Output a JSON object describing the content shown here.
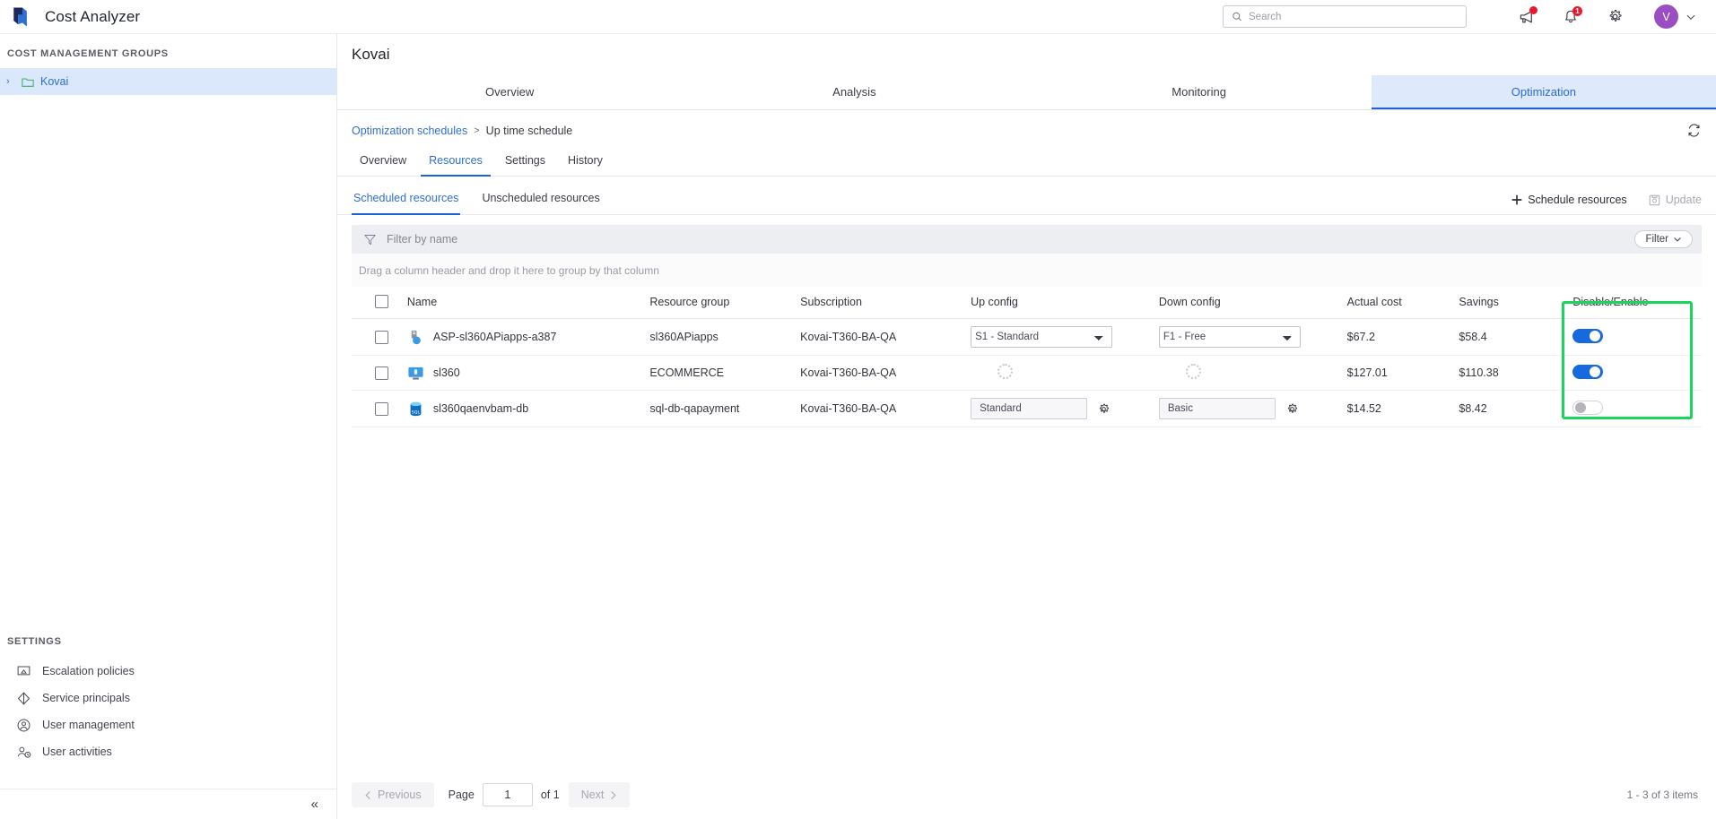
{
  "app": {
    "title": "Cost Analyzer",
    "logo_icon": "azure-cost-logo-icon"
  },
  "topbar": {
    "search_placeholder": "Search",
    "search_value": "",
    "search_icon": "search-icon",
    "announcement_icon": "megaphone-icon",
    "announcement_badge": "",
    "notifications_icon": "bell-icon",
    "notifications_badge": "1",
    "settings_icon": "gear-icon",
    "avatar_initial": "V",
    "avatar_chevron_icon": "chevron-down-icon"
  },
  "sidebar": {
    "groups_title": "COST MANAGEMENT GROUPS",
    "tree": [
      {
        "label": "Kovai",
        "expand_icon": "chevron-right-icon",
        "folder_icon": "folder-icon",
        "selected": true
      }
    ],
    "settings_title": "SETTINGS",
    "settings_items": [
      {
        "label": "Escalation policies",
        "icon": "escalation-policy-icon"
      },
      {
        "label": "Service principals",
        "icon": "service-principal-icon"
      },
      {
        "label": "User management",
        "icon": "user-circle-icon"
      },
      {
        "label": "User activities",
        "icon": "user-activity-icon"
      }
    ],
    "collapse_icon": "collapse-double-chevron-left-icon"
  },
  "main": {
    "page_title": "Kovai",
    "tabs": [
      {
        "label": "Overview",
        "active": false
      },
      {
        "label": "Analysis",
        "active": false
      },
      {
        "label": "Monitoring",
        "active": false
      },
      {
        "label": "Optimization",
        "active": true
      }
    ],
    "breadcrumb": {
      "parent": "Optimization schedules",
      "separator": ">",
      "current": "Up time schedule"
    },
    "refresh_icon": "refresh-icon",
    "sub_tabs": [
      {
        "label": "Overview",
        "active": false
      },
      {
        "label": "Resources",
        "active": true
      },
      {
        "label": "Settings",
        "active": false
      },
      {
        "label": "History",
        "active": false
      }
    ],
    "section_tabs": [
      {
        "label": "Scheduled resources",
        "active": true
      },
      {
        "label": "Unscheduled resources",
        "active": false
      }
    ],
    "actions": {
      "schedule_resources": "Schedule resources",
      "schedule_icon": "plus-icon",
      "update": "Update",
      "update_icon": "save-icon",
      "update_disabled": true
    },
    "filter": {
      "placeholder": "Filter by name",
      "value": "",
      "icon": "filter-funnel-icon",
      "button_label": "Filter",
      "button_chevron_icon": "chevron-down-icon"
    },
    "group_hint": "Drag a column header and drop it here to group by that column"
  },
  "table": {
    "headers": [
      "",
      "Name",
      "Resource group",
      "Subscription",
      "Up config",
      "Down config",
      "Actual cost",
      "Savings",
      "Disable/Enable"
    ],
    "select_all_checked": false,
    "rows": [
      {
        "checked": false,
        "name": "ASP-sl360APiapps-a387",
        "icon": "app-service-plan-icon",
        "resource_group": "sl360APiapps",
        "subscription": "Kovai-T360-BA-QA",
        "up_config": {
          "type": "select",
          "value": "S1 - Standard"
        },
        "down_config": {
          "type": "select",
          "value": "F1 - Free"
        },
        "actual_cost": "$67.2",
        "savings": "$58.4",
        "enabled": true
      },
      {
        "checked": false,
        "name": "sl360",
        "icon": "virtual-machine-icon",
        "resource_group": "ECOMMERCE",
        "subscription": "Kovai-T360-BA-QA",
        "up_config": {
          "type": "loading",
          "value": ""
        },
        "down_config": {
          "type": "loading",
          "value": ""
        },
        "actual_cost": "$127.01",
        "savings": "$110.38",
        "enabled": true
      },
      {
        "checked": false,
        "name": "sl360qaenvbam-db",
        "icon": "sql-database-icon",
        "resource_group": "sql-db-qapayment",
        "subscription": "Kovai-T360-BA-QA",
        "up_config": {
          "type": "boxed",
          "value": "Standard",
          "gear_icon": "gear-icon"
        },
        "down_config": {
          "type": "boxed",
          "value": "Basic",
          "gear_icon": "gear-icon"
        },
        "actual_cost": "$14.52",
        "savings": "$8.42",
        "enabled": false
      }
    ]
  },
  "pagination": {
    "previous_label": "Previous",
    "previous_icon": "chevron-left-icon",
    "page_label": "Page",
    "page_value": "1",
    "of_label": "of 1",
    "next_label": "Next",
    "next_icon": "chevron-right-icon",
    "items_summary": "1 - 3 of 3 items"
  },
  "colors": {
    "accent": "#1a63d6",
    "highlight": "#19d65b",
    "savings": "#2fa36b",
    "avatar": "#9a4ec2",
    "badge": "#e8192c"
  }
}
